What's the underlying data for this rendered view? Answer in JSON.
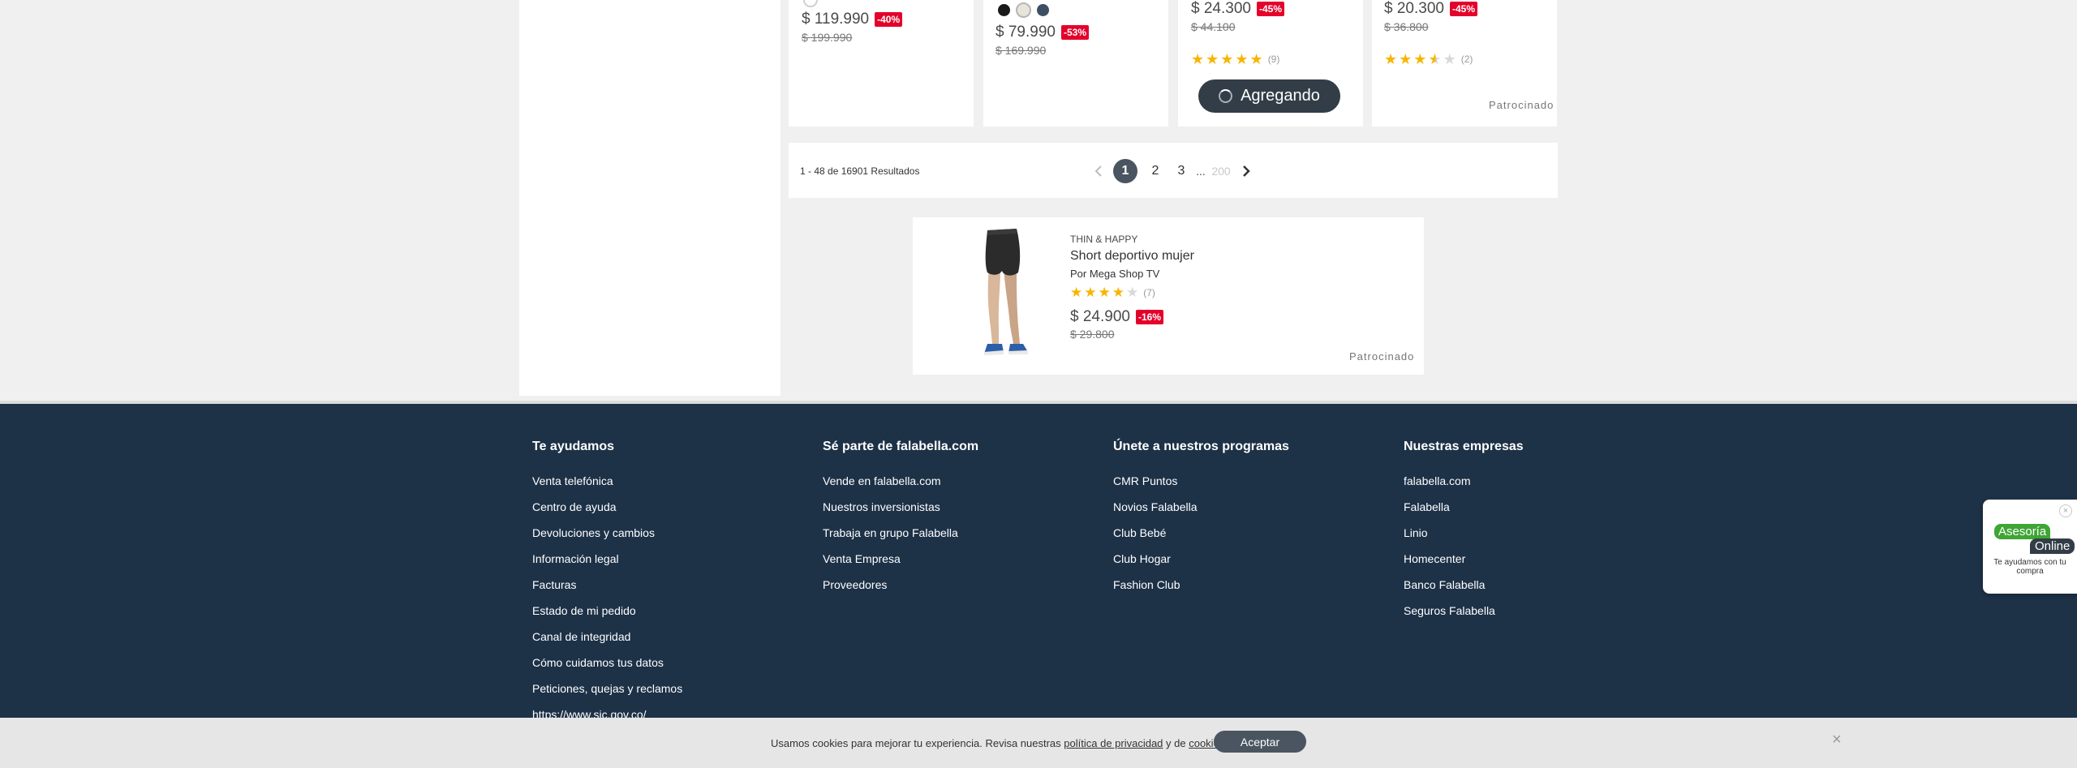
{
  "products_top": [
    {
      "price": "$ 119.990",
      "discount": "-40%",
      "old_price": "$ 199.990"
    },
    {
      "price": "$ 79.990",
      "discount": "-53%",
      "old_price": "$ 169.990",
      "swatch_colors": [
        "#1a1a1a",
        "#e8e4dc",
        "#3d4f63"
      ]
    },
    {
      "price": "$ 24.300",
      "discount": "-45%",
      "old_price": "$ 44.100",
      "rating": 5,
      "reviews": "(9)",
      "add_button": "Agregando"
    },
    {
      "price": "$ 20.300",
      "discount": "-45%",
      "old_price": "$ 36.800",
      "rating": 3.5,
      "reviews": "(2)",
      "sponsored": "Patrocinado"
    }
  ],
  "pagination": {
    "results": "1 - 48 de 16901 Resultados",
    "prev_icon": "chevron-left-icon",
    "pages": [
      "1",
      "2",
      "3"
    ],
    "ellipsis": "...",
    "last_page": "200",
    "next_icon": "chevron-right-icon",
    "current": "1"
  },
  "sponsored_product": {
    "brand": "THIN & HAPPY",
    "title": "Short deportivo mujer",
    "seller": "Por Mega Shop TV",
    "rating": 4,
    "reviews": "(7)",
    "price": "$ 24.900",
    "discount": "-16%",
    "old_price": "$ 29.800",
    "sponsored": "Patrocinado"
  },
  "footer": {
    "columns": [
      {
        "title": "Te ayudamos",
        "links": [
          "Venta telefónica",
          "Centro de ayuda",
          "Devoluciones y cambios",
          "Información legal",
          "Facturas",
          "Estado de mi pedido",
          "Canal de integridad",
          "Cómo cuidamos tus datos",
          "Peticiones, quejas y reclamos",
          "https://www.sic.gov.co/"
        ]
      },
      {
        "title": "Sé parte de falabella.com",
        "links": [
          "Vende en falabella.com",
          "Nuestros inversionistas",
          "Trabaja en grupo Falabella",
          "Venta Empresa",
          "Proveedores"
        ]
      },
      {
        "title": "Únete a nuestros programas",
        "links": [
          "CMR Puntos",
          "Novios Falabella",
          "Club Bebé",
          "Club Hogar",
          "Fashion Club"
        ]
      },
      {
        "title": "Nuestras empresas",
        "links": [
          "falabella.com",
          "Falabella",
          "Linio",
          "Homecenter",
          "Banco Falabella",
          "Seguros Falabella"
        ]
      }
    ]
  },
  "cookie": {
    "text_before": "Usamos cookies para mejorar tu experiencia. Revisa nuestras ",
    "privacy_link": "política de privacidad",
    "text_middle": " y de ",
    "cookies_link": "cookies",
    "text_after": ".",
    "accept": "Aceptar",
    "close_icon": "×"
  },
  "chat": {
    "line1": "Asesoría",
    "line2": "Online",
    "subtitle": "Te ayudamos con tu compra",
    "close_icon": "×"
  },
  "colors": {
    "footer_bg": "#1d3147",
    "discount_badge": "#e4002b",
    "button_dark": "#333d47",
    "star": "#f7b500",
    "chat_green": "#3fa535"
  }
}
